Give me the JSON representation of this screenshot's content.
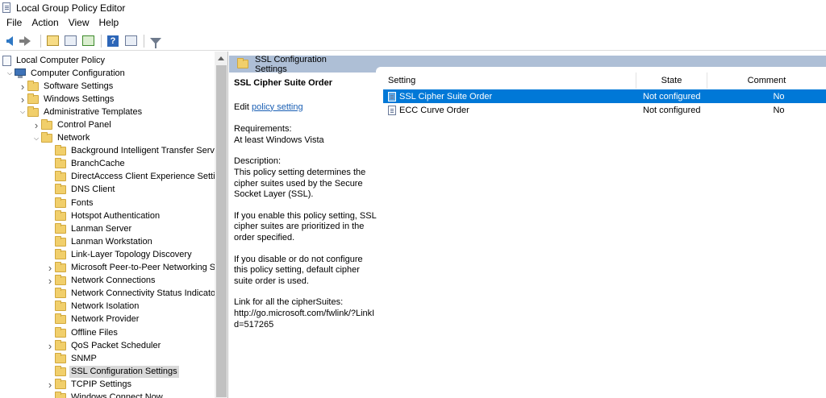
{
  "window": {
    "title": "Local Group Policy Editor"
  },
  "menu": [
    "File",
    "Action",
    "View",
    "Help"
  ],
  "toolbar": {
    "icons": [
      "back-arrow-icon",
      "forward-arrow-icon",
      "up-folder-icon",
      "show-hide-tree-icon",
      "export-list-icon",
      "help-icon",
      "properties-icon",
      "filter-icon"
    ]
  },
  "tree": {
    "items": [
      {
        "label": "Local Computer Policy",
        "level": 0,
        "expander": "",
        "icon": "policy-doc"
      },
      {
        "label": "Computer Configuration",
        "level": 1,
        "expander": "open",
        "icon": "computer"
      },
      {
        "label": "Software Settings",
        "level": 2,
        "expander": "closed",
        "icon": "folder"
      },
      {
        "label": "Windows Settings",
        "level": 2,
        "expander": "closed",
        "icon": "folder"
      },
      {
        "label": "Administrative Templates",
        "level": 2,
        "expander": "open",
        "icon": "folder"
      },
      {
        "label": "Control Panel",
        "level": 3,
        "expander": "closed",
        "icon": "folder"
      },
      {
        "label": "Network",
        "level": 3,
        "expander": "open",
        "icon": "folder"
      },
      {
        "label": "Background Intelligent Transfer Servic",
        "level": 4,
        "expander": "",
        "icon": "folder"
      },
      {
        "label": "BranchCache",
        "level": 4,
        "expander": "",
        "icon": "folder"
      },
      {
        "label": "DirectAccess Client Experience Setting",
        "level": 4,
        "expander": "",
        "icon": "folder"
      },
      {
        "label": "DNS Client",
        "level": 4,
        "expander": "",
        "icon": "folder"
      },
      {
        "label": "Fonts",
        "level": 4,
        "expander": "",
        "icon": "folder"
      },
      {
        "label": "Hotspot Authentication",
        "level": 4,
        "expander": "",
        "icon": "folder"
      },
      {
        "label": "Lanman Server",
        "level": 4,
        "expander": "",
        "icon": "folder"
      },
      {
        "label": "Lanman Workstation",
        "level": 4,
        "expander": "",
        "icon": "folder"
      },
      {
        "label": "Link-Layer Topology Discovery",
        "level": 4,
        "expander": "",
        "icon": "folder"
      },
      {
        "label": "Microsoft Peer-to-Peer Networking S",
        "level": 4,
        "expander": "closed",
        "icon": "folder"
      },
      {
        "label": "Network Connections",
        "level": 4,
        "expander": "closed",
        "icon": "folder"
      },
      {
        "label": "Network Connectivity Status Indicato",
        "level": 4,
        "expander": "",
        "icon": "folder"
      },
      {
        "label": "Network Isolation",
        "level": 4,
        "expander": "",
        "icon": "folder"
      },
      {
        "label": "Network Provider",
        "level": 4,
        "expander": "",
        "icon": "folder"
      },
      {
        "label": "Offline Files",
        "level": 4,
        "expander": "",
        "icon": "folder"
      },
      {
        "label": "QoS Packet Scheduler",
        "level": 4,
        "expander": "closed",
        "icon": "folder"
      },
      {
        "label": "SNMP",
        "level": 4,
        "expander": "",
        "icon": "folder"
      },
      {
        "label": "SSL Configuration Settings",
        "level": 4,
        "expander": "",
        "icon": "folder",
        "selected": true
      },
      {
        "label": "TCPIP Settings",
        "level": 4,
        "expander": "closed",
        "icon": "folder"
      },
      {
        "label": "Windows Connect Now",
        "level": 4,
        "expander": "",
        "icon": "folder"
      }
    ]
  },
  "content_header": {
    "title": "SSL Configuration Settings"
  },
  "description": {
    "title": "SSL Cipher Suite Order",
    "edit_prefix": "Edit ",
    "edit_link": "policy setting",
    "requirements_label": "Requirements:",
    "requirements_value": "At least Windows Vista",
    "description_label": "Description:",
    "paragraphs": [
      "This policy setting determines the cipher suites used by the Secure Socket Layer (SSL).",
      "If you enable this policy setting, SSL cipher suites are prioritized in the order specified.",
      "If you disable or do not configure this policy setting, default cipher suite order is used."
    ],
    "link_label": "Link for all the cipherSuites:",
    "link_url": "http://go.microsoft.com/fwlink/?LinkId=517265"
  },
  "list": {
    "columns": {
      "setting": "Setting",
      "state": "State",
      "comment": "Comment"
    },
    "rows": [
      {
        "setting": "SSL Cipher Suite Order",
        "state": "Not configured",
        "comment": "No",
        "selected": true
      },
      {
        "setting": "ECC Curve Order",
        "state": "Not configured",
        "comment": "No",
        "selected": false
      }
    ]
  },
  "colors": {
    "selection": "#0078d7",
    "header_band": "#aebfd6",
    "link": "#1a5fb4",
    "folder": "#f1cf6b"
  }
}
